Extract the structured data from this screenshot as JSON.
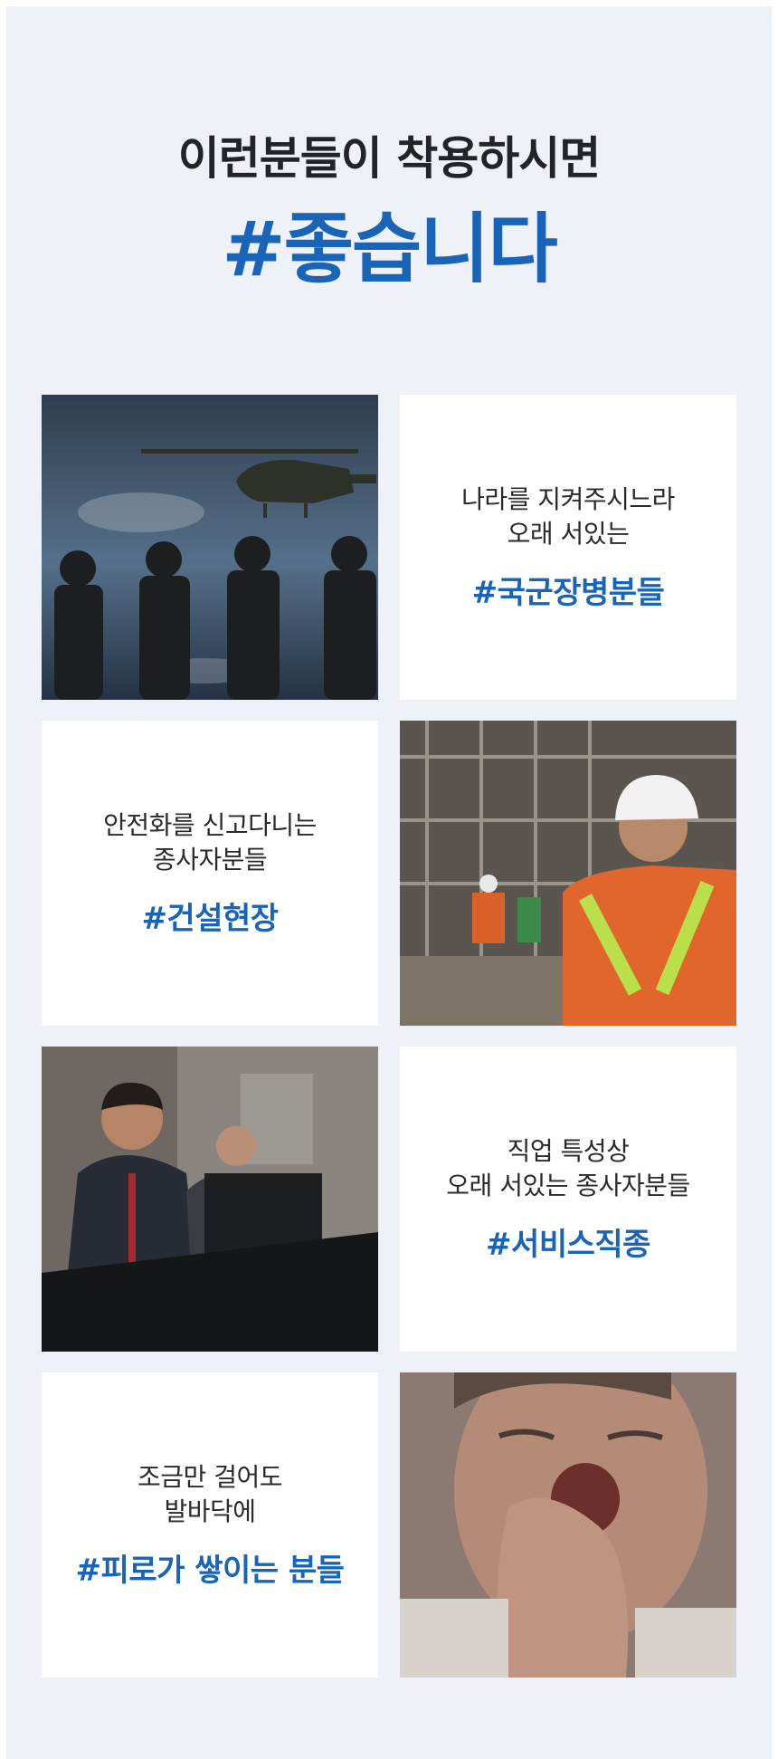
{
  "header": {
    "title": "이런분들이 착용하시면",
    "highlight": "#좋습니다"
  },
  "cards": [
    {
      "line1": "나라를 지켜주시느라",
      "line2": "오래 서있는",
      "tag": "#국군장병분들"
    },
    {
      "line1": "안전화를 신고다니는",
      "line2": "종사자분들",
      "tag": "#건설현장"
    },
    {
      "line1": "직업 특성상",
      "line2": "오래 서있는 종사자분들",
      "tag": "#서비스직종"
    },
    {
      "line1": "조금만 걸어도",
      "line2": "발바닥에",
      "tag": "#피로가 쌓이는 분들"
    }
  ],
  "colors": {
    "accent": "#1a64b8",
    "background": "#eef2f8",
    "title": "#222428"
  }
}
